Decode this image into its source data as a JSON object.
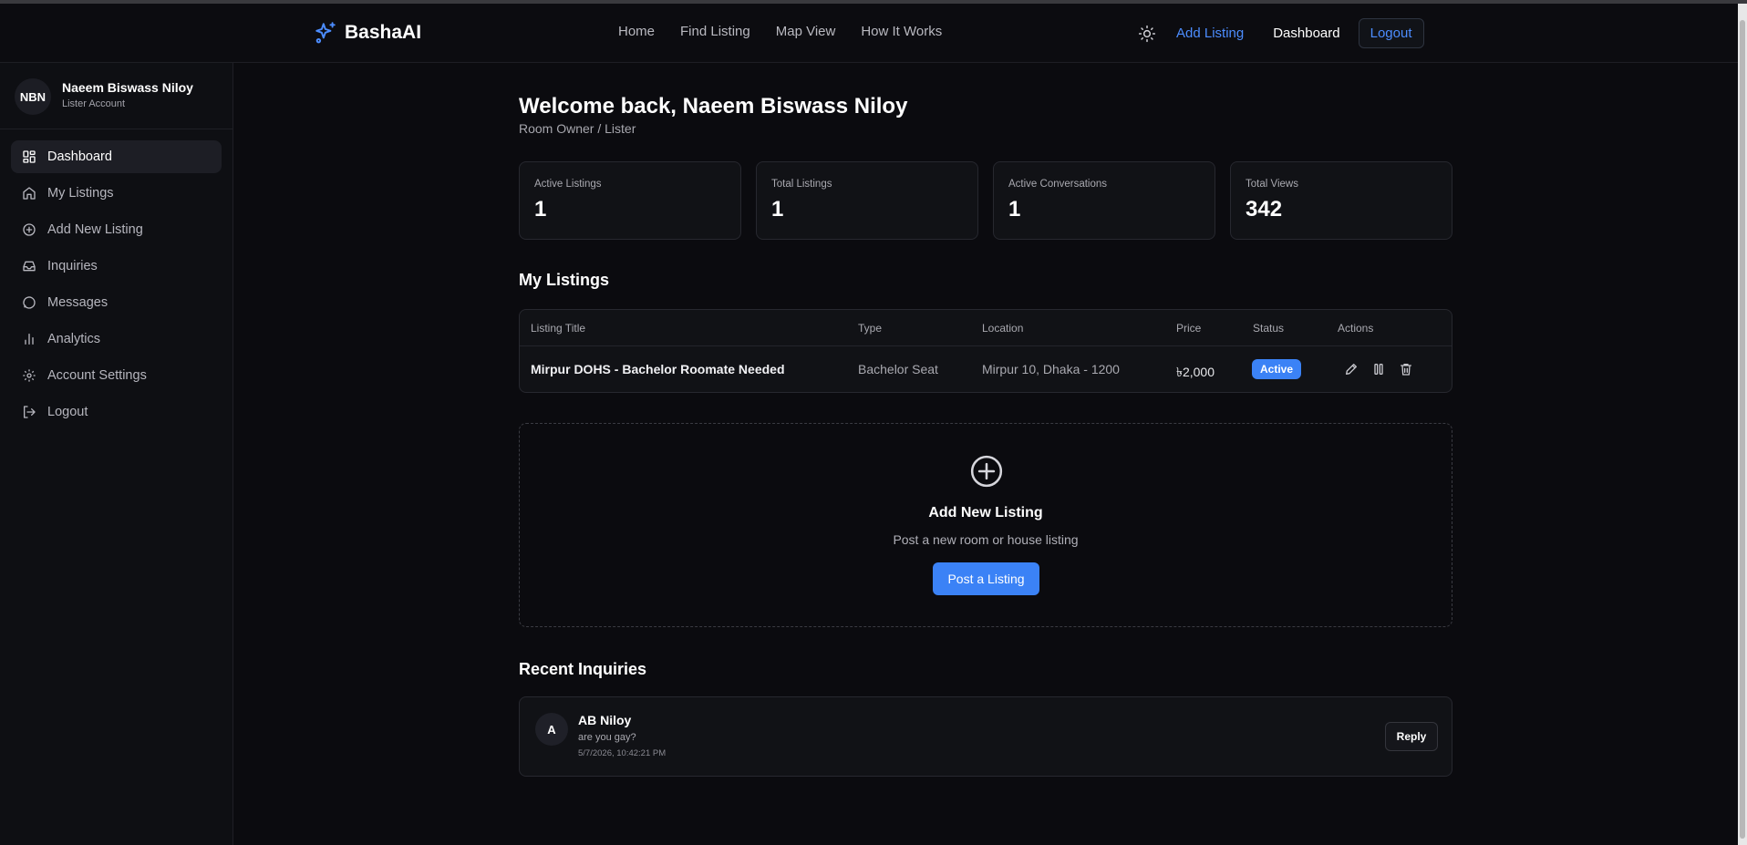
{
  "header": {
    "brand": "BashaAI",
    "nav": [
      "Home",
      "Find Listing",
      "Map View",
      "How It Works"
    ],
    "add_listing": "Add Listing",
    "dashboard": "Dashboard",
    "logout": "Logout",
    "theme_icon": "sun-icon"
  },
  "sidebar": {
    "profile": {
      "initials": "NBN",
      "name": "Naeem Biswass Niloy",
      "role": "Lister Account"
    },
    "items": [
      {
        "label": "Dashboard",
        "icon": "dashboard-icon",
        "active": true
      },
      {
        "label": "My Listings",
        "icon": "home-icon"
      },
      {
        "label": "Add New Listing",
        "icon": "plus-circle-icon"
      },
      {
        "label": "Inquiries",
        "icon": "inbox-icon"
      },
      {
        "label": "Messages",
        "icon": "message-icon"
      },
      {
        "label": "Analytics",
        "icon": "bar-chart-icon"
      },
      {
        "label": "Account Settings",
        "icon": "gear-icon"
      },
      {
        "label": "Logout",
        "icon": "logout-icon"
      }
    ]
  },
  "main": {
    "welcome": "Welcome back, Naeem Biswass Niloy",
    "subtitle": "Room Owner / Lister",
    "stats": [
      {
        "label": "Active Listings",
        "value": "1"
      },
      {
        "label": "Total Listings",
        "value": "1"
      },
      {
        "label": "Active Conversations",
        "value": "1"
      },
      {
        "label": "Total Views",
        "value": "342"
      }
    ],
    "listings_title": "My Listings",
    "table": {
      "headers": [
        "Listing Title",
        "Type",
        "Location",
        "Price",
        "Status",
        "Actions"
      ],
      "rows": [
        {
          "title": "Mirpur DOHS - Bachelor Roomate Needed",
          "type": "Bachelor Seat",
          "location": "Mirpur 10, Dhaka - 1200",
          "price": "৳2,000",
          "status": "Active"
        }
      ]
    },
    "add_box": {
      "title": "Add New Listing",
      "subtitle": "Post a new room or house listing",
      "button": "Post a Listing"
    },
    "inquiries_title": "Recent Inquiries",
    "inquiries": [
      {
        "initial": "A",
        "name": "AB Niloy",
        "message": "are you gay?",
        "time": "5/7/2026, 10:42:21 PM",
        "reply": "Reply"
      }
    ]
  },
  "colors": {
    "accent": "#3b82f6",
    "link": "#4c8dff",
    "background": "#0b0b0f"
  }
}
